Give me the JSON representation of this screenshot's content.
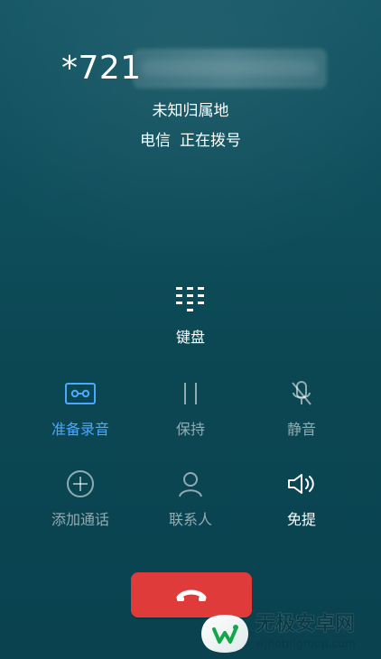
{
  "call": {
    "number_visible": "*721",
    "location": "未知归属地",
    "carrier": "电信",
    "status": "正在拨号"
  },
  "keypad": {
    "label": "键盘",
    "icon": "dialpad-icon"
  },
  "actions": {
    "row1": [
      {
        "label": "准备录音",
        "icon": "record-cassette-icon",
        "state": "active"
      },
      {
        "label": "保持",
        "icon": "hold-icon",
        "state": "disabled"
      },
      {
        "label": "静音",
        "icon": "mic-off-icon",
        "state": "disabled"
      }
    ],
    "row2": [
      {
        "label": "添加通话",
        "icon": "add-call-icon",
        "state": "disabled"
      },
      {
        "label": "联系人",
        "icon": "contacts-icon",
        "state": "disabled"
      },
      {
        "label": "免提",
        "icon": "speaker-icon",
        "state": "enabled"
      }
    ]
  },
  "end_call": {
    "icon": "end-call-icon",
    "color": "#e03b3b"
  },
  "watermark": {
    "title": "无极安卓网",
    "url": "wjhotelgroup.com"
  },
  "colors": {
    "accent": "#4aa8ff",
    "text_primary": "#ffffff",
    "text_muted": "rgba(255,255,255,0.55)",
    "end_call": "#e03b3b"
  }
}
